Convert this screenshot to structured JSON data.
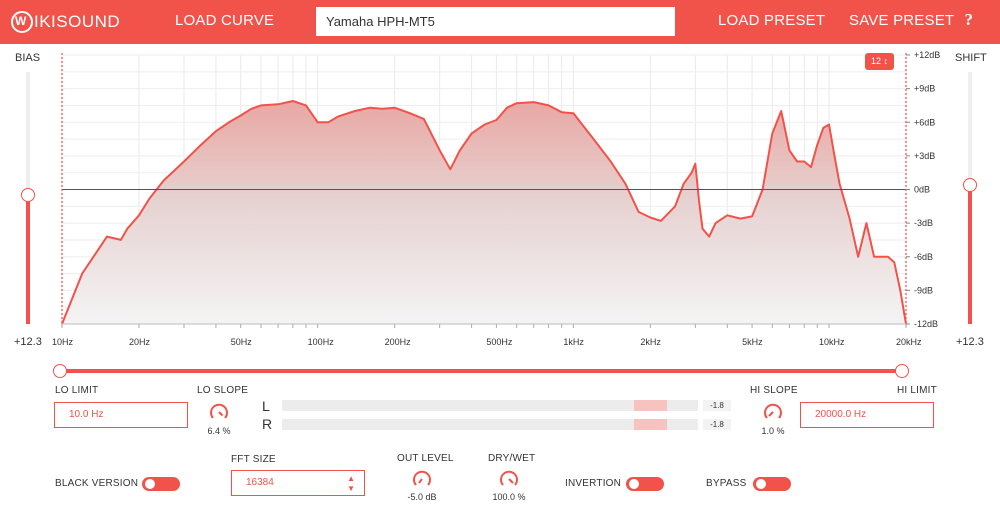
{
  "header": {
    "logo_text": "IKISOUND",
    "load_curve_label": "LOAD CURVE",
    "curve_name": "Yamaha HPH-MT5",
    "load_preset_label": "LOAD PRESET",
    "save_preset_label": "SAVE PRESET",
    "help_label": "?"
  },
  "bias": {
    "label": "BIAS",
    "value": "+12.3",
    "level": 0.51
  },
  "shift": {
    "label": "SHIFT",
    "value": "+12.3",
    "level": 0.55
  },
  "preset_badge": "12 ↕",
  "chart_data": {
    "type": "area",
    "xscale": "log",
    "x_range": [
      10,
      20000
    ],
    "ylim": [
      -12,
      12
    ],
    "x_ticks": [
      "10Hz",
      "20Hz",
      "50Hz",
      "100Hz",
      "200Hz",
      "500Hz",
      "1kHz",
      "2kHz",
      "5kHz",
      "10kHz",
      "20kHz"
    ],
    "y_ticks": [
      "+12dB",
      "+9dB",
      "+6dB",
      "+3dB",
      "0dB",
      "-3dB",
      "-6dB",
      "-9dB",
      "-12dB"
    ],
    "series": [
      {
        "x": [
          10,
          12,
          15,
          17,
          18,
          20,
          22,
          25,
          30,
          35,
          40,
          45,
          50,
          55,
          60,
          70,
          80,
          90,
          100,
          110,
          120,
          140,
          160,
          180,
          200,
          230,
          260,
          300,
          330,
          360,
          400,
          450,
          500,
          550,
          600,
          700,
          800,
          900,
          1000,
          1200,
          1400,
          1600,
          1800,
          2000,
          2200,
          2500,
          2700,
          2900,
          3000,
          3100,
          3200,
          3400,
          3600,
          4000,
          4500,
          5000,
          5500,
          6000,
          6500,
          7000,
          7500,
          8000,
          8500,
          9000,
          9500,
          10000,
          10500,
          11000,
          12000,
          13000,
          14000,
          15000,
          16000,
          17000,
          18000,
          19000,
          20000
        ],
        "y": [
          -12,
          -7.5,
          -4.2,
          -4.5,
          -3.5,
          -2.3,
          -0.8,
          0.8,
          2.5,
          4,
          5.2,
          6,
          6.6,
          7.2,
          7.5,
          7.6,
          7.9,
          7.5,
          6,
          6,
          6.5,
          7,
          7.3,
          7.2,
          7.3,
          6.8,
          6.3,
          3.5,
          1.8,
          3.5,
          5,
          5.8,
          6.2,
          7.3,
          7.7,
          7.8,
          7.5,
          6.9,
          6.8,
          4.5,
          2.5,
          0.5,
          -2,
          -2.5,
          -2.8,
          -1.5,
          0.5,
          1.5,
          2.3,
          -1,
          -3.5,
          -4.2,
          -3,
          -2.3,
          -2.6,
          -2.4,
          0,
          5,
          7,
          3.5,
          2.5,
          2.5,
          2,
          4,
          5.5,
          5.8,
          3,
          0.5,
          -2.5,
          -6,
          -3,
          -6,
          -6,
          -6,
          -6.5,
          -9,
          -12
        ]
      }
    ]
  },
  "lo_limit": {
    "label": "LO LIMIT",
    "value": "10.0 Hz"
  },
  "hi_limit": {
    "label": "HI LIMIT",
    "value": "20000.0 Hz"
  },
  "lo_slope": {
    "label": "LO SLOPE",
    "value": "6.4 %"
  },
  "hi_slope": {
    "label": "HI SLOPE",
    "value": "1.0 %"
  },
  "meters": {
    "left": {
      "label": "L",
      "value": "-1.8",
      "level": 0.92
    },
    "right": {
      "label": "R",
      "value": "-1.8",
      "level": 0.92
    }
  },
  "black_version": {
    "label": "BLACK VERSION"
  },
  "fft_size": {
    "label": "FFT SIZE",
    "value": "16384"
  },
  "out_level": {
    "label": "OUT LEVEL",
    "value": "-5.0 dB"
  },
  "dry_wet": {
    "label": "DRY/WET",
    "value": "100.0 %"
  },
  "invertion": {
    "label": "INVERTION"
  },
  "bypass": {
    "label": "BYPASS"
  },
  "colors": {
    "accent": "#f1524a",
    "grid": "#e6e6e6"
  }
}
